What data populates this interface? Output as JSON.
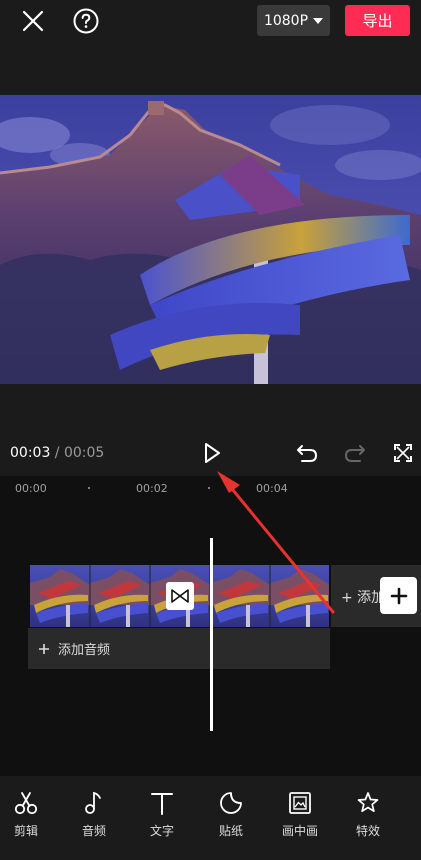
{
  "header": {
    "resolution_label": "1080P",
    "export_label": "导出"
  },
  "player": {
    "current_time": "00:03",
    "separator": " / ",
    "total_time": "00:05"
  },
  "timeline": {
    "ruler": [
      "00:00",
      "00:02",
      "00:04"
    ],
    "add_clip_label": "+ 添加",
    "add_audio_label": "添加音频"
  },
  "toolbar": {
    "items": [
      {
        "label": "剪辑",
        "icon": "scissors-icon"
      },
      {
        "label": "音频",
        "icon": "music-note-icon"
      },
      {
        "label": "文字",
        "icon": "text-icon"
      },
      {
        "label": "贴纸",
        "icon": "sticker-icon"
      },
      {
        "label": "画中画",
        "icon": "picture-in-picture-icon"
      },
      {
        "label": "特效",
        "icon": "effects-star-icon"
      }
    ]
  },
  "colors": {
    "accent": "#fe2c55",
    "annotation_arrow": "#e8322e"
  }
}
